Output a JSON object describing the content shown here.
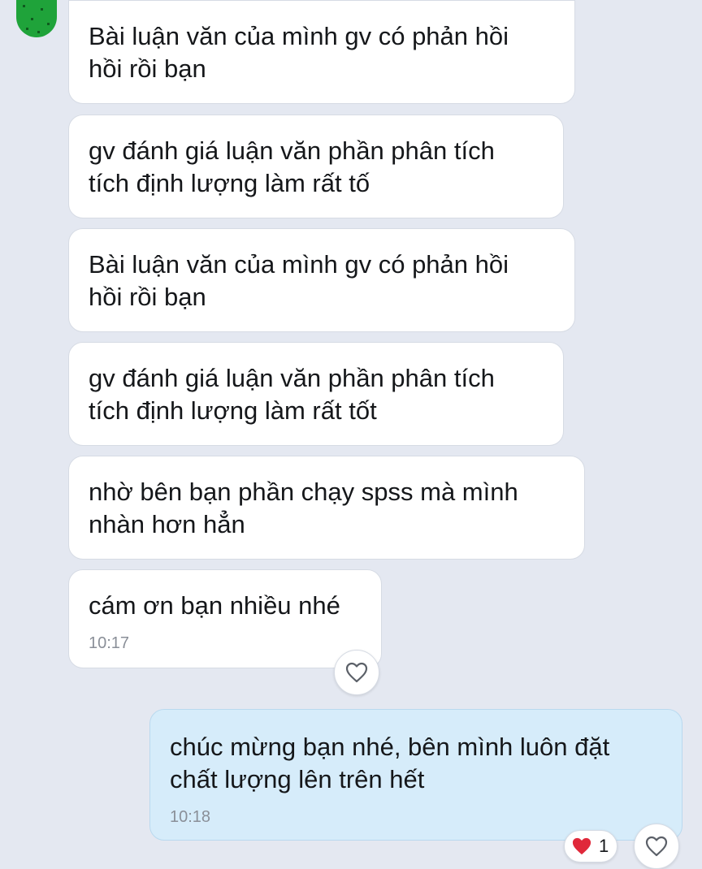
{
  "messages": [
    {
      "lines": [
        "Bài luận văn của mình gv có phản hồi",
        "hồi rồi bạn"
      ]
    },
    {
      "lines": [
        "gv đánh giá luận văn phần phân tích",
        "tích định lượng làm rất tố"
      ]
    },
    {
      "lines": [
        "Bài luận văn của mình gv có phản hồi",
        "hồi rồi bạn"
      ]
    },
    {
      "lines": [
        "gv đánh giá luận văn phần phân tích",
        "tích định lượng làm rất tốt"
      ]
    },
    {
      "lines": [
        "nhờ bên bạn phần chạy spss mà mình",
        "nhàn hơn hẳn"
      ]
    },
    {
      "lines": [
        "cám ơn bạn nhiều nhé"
      ],
      "time": "10:17"
    },
    {
      "lines": [
        "chúc mừng bạn nhé, bên mình luôn đặt",
        "chất lượng lên trên hết"
      ],
      "time": "10:18"
    }
  ],
  "reactions": {
    "outgoing_heart_count": "1"
  },
  "icons": {
    "react": "heart-outline-icon",
    "reaction": "red-heart-icon"
  },
  "colors": {
    "background": "#e4e8f1",
    "incoming_bubble": "#ffffff",
    "outgoing_bubble": "#d6ecfa",
    "heart_red": "#e0283a"
  }
}
